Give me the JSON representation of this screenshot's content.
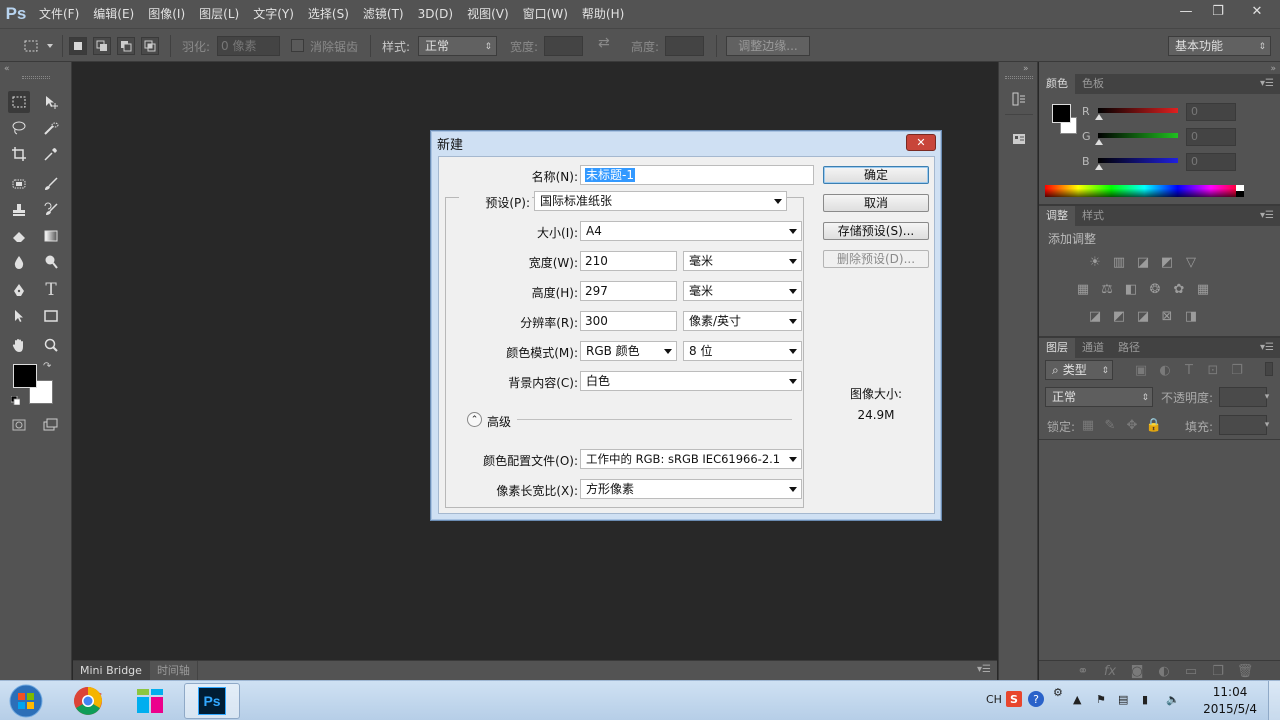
{
  "app": {
    "logo": "Ps"
  },
  "menu": [
    "文件(F)",
    "编辑(E)",
    "图像(I)",
    "图层(L)",
    "文字(Y)",
    "选择(S)",
    "滤镜(T)",
    "3D(D)",
    "视图(V)",
    "窗口(W)",
    "帮助(H)"
  ],
  "window_controls": {
    "minimize": "—",
    "restore": "❐",
    "close": "✕"
  },
  "options": {
    "feather_label": "羽化:",
    "feather_value": "0 像素",
    "antialias_label": "消除锯齿",
    "style_label": "样式:",
    "style_value": "正常",
    "width_label": "宽度:",
    "height_label": "高度:",
    "refine_edge": "调整边缘...",
    "workspace": "基本功能"
  },
  "bottom_tabs": [
    "Mini Bridge",
    "时间轴"
  ],
  "color_panel": {
    "tabs": [
      "颜色",
      "色板"
    ],
    "channels": [
      {
        "label": "R",
        "value": "0",
        "color": "#e02020"
      },
      {
        "label": "G",
        "value": "0",
        "color": "#20c020"
      },
      {
        "label": "B",
        "value": "0",
        "color": "#2020e0"
      }
    ]
  },
  "adjust_panel": {
    "tabs": [
      "调整",
      "样式"
    ],
    "add_label": "添加调整"
  },
  "layers_panel": {
    "tabs": [
      "图层",
      "通道",
      "路径"
    ],
    "filter_label": "类型",
    "blend_mode": "正常",
    "opacity_label": "不透明度:",
    "lock_label": "锁定:",
    "fill_label": "填充:"
  },
  "dialog": {
    "title": "新建",
    "close": "✕",
    "name_label": "名称(N):",
    "name_value": "未标题-1",
    "preset_label": "预设(P):",
    "preset_value": "国际标准纸张",
    "size_label": "大小(I):",
    "size_value": "A4",
    "width_label": "宽度(W):",
    "width_value": "210",
    "width_unit": "毫米",
    "height_label": "高度(H):",
    "height_value": "297",
    "height_unit": "毫米",
    "resolution_label": "分辨率(R):",
    "resolution_value": "300",
    "resolution_unit": "像素/英寸",
    "color_mode_label": "颜色模式(M):",
    "color_mode_value": "RGB 颜色",
    "bit_depth": "8 位",
    "background_label": "背景内容(C):",
    "background_value": "白色",
    "advanced_label": "高级",
    "profile_label": "颜色配置文件(O):",
    "profile_value": "工作中的 RGB: sRGB IEC61966-2.1",
    "aspect_label": "像素长宽比(X):",
    "aspect_value": "方形像素",
    "ok": "确定",
    "cancel": "取消",
    "save_preset": "存储预设(S)...",
    "delete_preset": "删除预设(D)...",
    "image_size_label": "图像大小:",
    "image_size_value": "24.9M"
  },
  "taskbar": {
    "lang": "CH",
    "time": "11:04",
    "date": "2015/5/4",
    "ps_label": "Ps"
  }
}
